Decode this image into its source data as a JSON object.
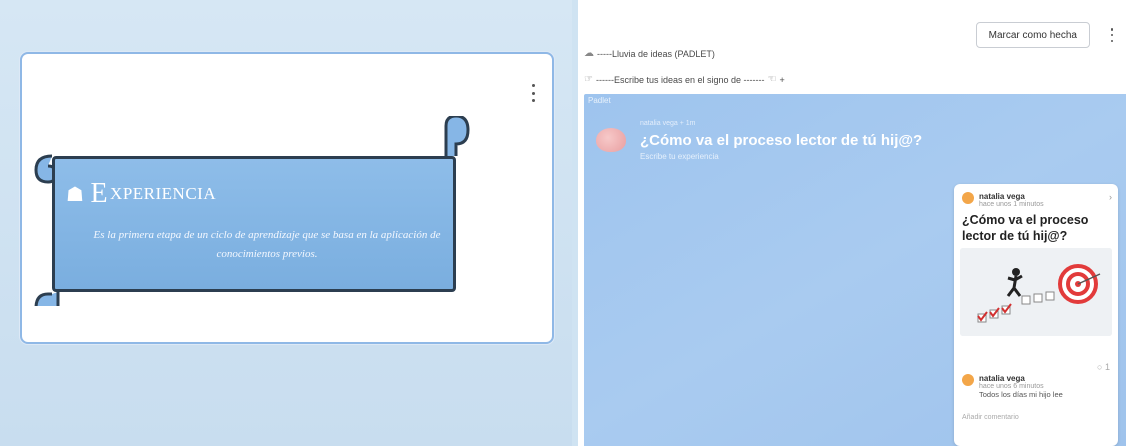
{
  "slide": {
    "title_initial": "E",
    "title_rest": "XPERIENCIA",
    "description": "Es la primera etapa de un ciclo de aprendizaje que se basa en la aplicación de conocimientos previos."
  },
  "activity": {
    "mark_done_label": "Marcar como hecha",
    "line1": "-----Lluvia de ideas (PADLET)",
    "line2": "------Escribe tus ideas en el  signo de -------",
    "plus": "+"
  },
  "padlet": {
    "tag": "Padlet",
    "meta": "natalia vega + 1m",
    "title": "¿Cómo va el proceso lector de tú hij@?",
    "subtitle": "Escribe tu experiencia",
    "post": {
      "author": "natalia vega",
      "time": "hace unos 1 minutos",
      "title": "¿Cómo va el proceso lector de tú hij@?",
      "comment_count": "1",
      "comment_author": "natalia vega",
      "comment_time": "hace unos 6 minutos",
      "comment_text": "Todos los días mi hijo lee",
      "add_comment": "Añadir comentario"
    }
  },
  "colors": {
    "padlet_bg": "#a3c7ef",
    "banner_fill": "#86b6e6",
    "avatar": "#f3a649"
  }
}
